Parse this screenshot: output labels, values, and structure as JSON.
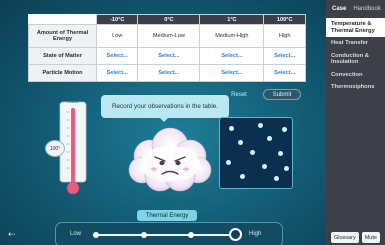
{
  "table": {
    "headers": [
      "-10°C",
      "0°C",
      "1°C",
      "100°C"
    ],
    "rows": [
      {
        "label": "Amount of Thermal Energy",
        "cells": [
          "Low",
          "Medium-Low",
          "Medium-High",
          "High"
        ]
      },
      {
        "label": "State of Matter",
        "cells": [
          "Select...",
          "Select...",
          "Select...",
          "Select..."
        ]
      },
      {
        "label": "Particle Motion",
        "cells": [
          "Select...",
          "Select...",
          "Select...",
          "Select..."
        ]
      }
    ]
  },
  "buttons": {
    "reset": "Reset",
    "submit": "Submit"
  },
  "tooltip": "Record your observations in the table.",
  "thermometer": {
    "unit": "Celsius",
    "reading": "100°",
    "level": 1.0
  },
  "slider": {
    "title": "Thermal Energy",
    "low": "Low",
    "high": "High",
    "position": "High"
  },
  "sidebar": {
    "tabs": [
      "Case",
      "Handbook"
    ],
    "items": [
      "Temperature & Thermal Energy",
      "Heat Transfer",
      "Conduction & Insulation",
      "Convection",
      "Thermosiphons"
    ],
    "active_item": "Temperature & Thermal Energy",
    "footer": [
      "Glossary",
      "Mute"
    ]
  },
  "icons": {
    "back": "back-arrow-icon"
  }
}
